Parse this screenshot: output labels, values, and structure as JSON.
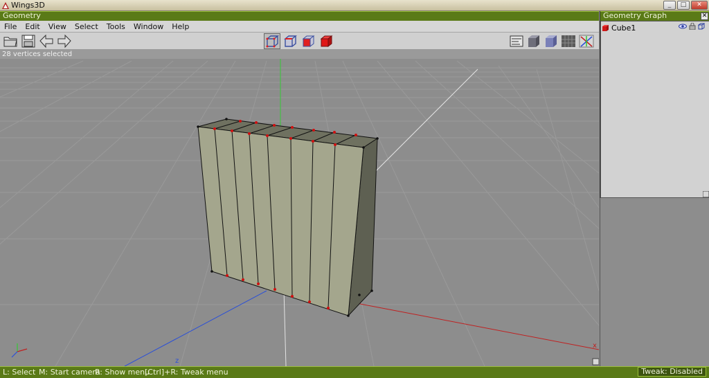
{
  "window": {
    "title": "Wings3D",
    "minimize": "_",
    "maximize": "□",
    "close": "✕"
  },
  "panels": {
    "geometry_title": "Geometry",
    "graph_title": "Geometry Graph",
    "close_glyph": "✕"
  },
  "menu": [
    "File",
    "Edit",
    "View",
    "Select",
    "Tools",
    "Window",
    "Help"
  ],
  "status": {
    "selection": "28 vertices selected"
  },
  "geometry_graph": {
    "object_name": "Cube1"
  },
  "axes": {
    "x_label": "x",
    "z_label": "z"
  },
  "bottom": {
    "left_hint": "L: Select",
    "middle_hint": "M: Start camera",
    "right_hint": "R: Show menu",
    "tweak_hint": "[Ctrl]+R: Tweak menu",
    "tweak_status": "Tweak: Disabled"
  },
  "colors": {
    "panel_green": "#5a7a17",
    "model_fill": "#a4a68d",
    "vertex_red": "#d01010",
    "axis_green": "#35c935",
    "axis_blue": "#2a4fd8",
    "axis_red": "#c02020"
  }
}
